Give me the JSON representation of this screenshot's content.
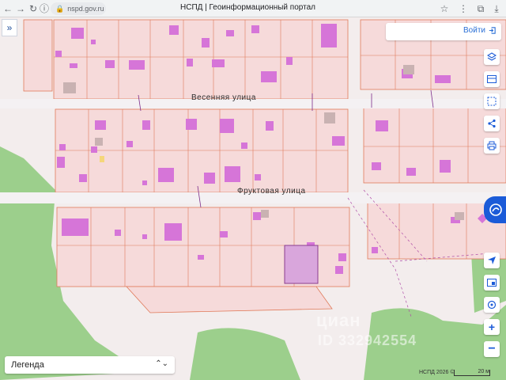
{
  "browser": {
    "url": "nspd.gov.ru",
    "tab_title": "НСПД | Геоинформационный портал"
  },
  "map": {
    "streets": [
      "Весенняя улица",
      "Фруктовая улица"
    ],
    "login_label": "Войти",
    "legend_label": "Легенда",
    "attribution": "НСПД 2026 ©",
    "scale_label": "20 м",
    "watermark_line1": "циан",
    "watermark_line2": "ID 332942554"
  },
  "icons": {
    "expand": "double-chevron-right-icon",
    "login": "login-icon",
    "controls": [
      "layers-icon",
      "card-icon",
      "ruler-icon",
      "share-icon",
      "print-icon",
      "locate-icon",
      "tag-icon",
      "geolocation-icon",
      "zoom-in-icon",
      "zoom-out-icon"
    ]
  },
  "colors": {
    "parcel_fill": "#f6dada",
    "parcel_border": "#e07a5a",
    "building": "#d675d8",
    "selected_parcel": "#d9a6dc",
    "forest": "#9ccf8c",
    "road": "#f4f1f3",
    "accent": "#1b5bd8"
  }
}
